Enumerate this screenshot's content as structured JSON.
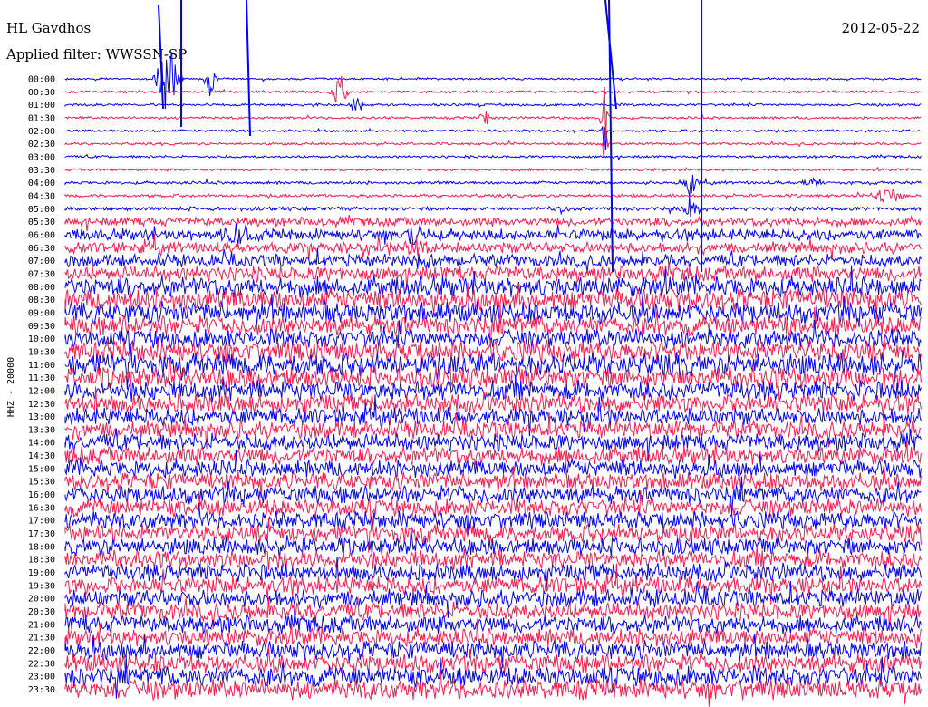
{
  "header": {
    "station": "HL Gavdhos",
    "date": "2012-05-22",
    "filter": "Applied filter: WWSSN-SP"
  },
  "chart_data": {
    "type": "line",
    "title": "HL Gavdhos",
    "ylabel": "HHZ - 20000",
    "colors": [
      "#0000ff",
      "#ff1a4d"
    ],
    "grid": false,
    "legend": "none",
    "traces_per_row_minutes": 30,
    "row_labels": [
      "00:00",
      "00:30",
      "01:00",
      "01:30",
      "02:00",
      "02:30",
      "03:00",
      "03:30",
      "04:00",
      "04:30",
      "05:00",
      "05:30",
      "06:00",
      "06:30",
      "07:00",
      "07:30",
      "08:00",
      "08:30",
      "09:00",
      "09:30",
      "10:00",
      "10:30",
      "11:00",
      "11:30",
      "12:00",
      "12:30",
      "13:00",
      "13:30",
      "14:00",
      "14:30",
      "15:00",
      "15:30",
      "16:00",
      "16:30",
      "17:00",
      "17:30",
      "18:00",
      "18:30",
      "19:00",
      "19:30",
      "20:00",
      "20:30",
      "21:00",
      "21:30",
      "22:00",
      "22:30",
      "23:00",
      "23:30"
    ],
    "series": [
      {
        "values": [
          0.08,
          0.1,
          0.1,
          0.1,
          0.1,
          0.1,
          0.1,
          0.1,
          0.12,
          0.12,
          0.16,
          0.35,
          0.45,
          0.45,
          0.5,
          0.6,
          0.8,
          0.85,
          0.85,
          0.8,
          0.75,
          0.85,
          0.9,
          0.85,
          0.8,
          0.75,
          0.7,
          0.7,
          0.7,
          0.7,
          0.7,
          0.7,
          0.7,
          0.7,
          0.7,
          0.7,
          0.7,
          0.7,
          0.7,
          0.7,
          0.7,
          0.7,
          0.7,
          0.7,
          0.75,
          0.75,
          0.8,
          0.8
        ]
      }
    ]
  }
}
